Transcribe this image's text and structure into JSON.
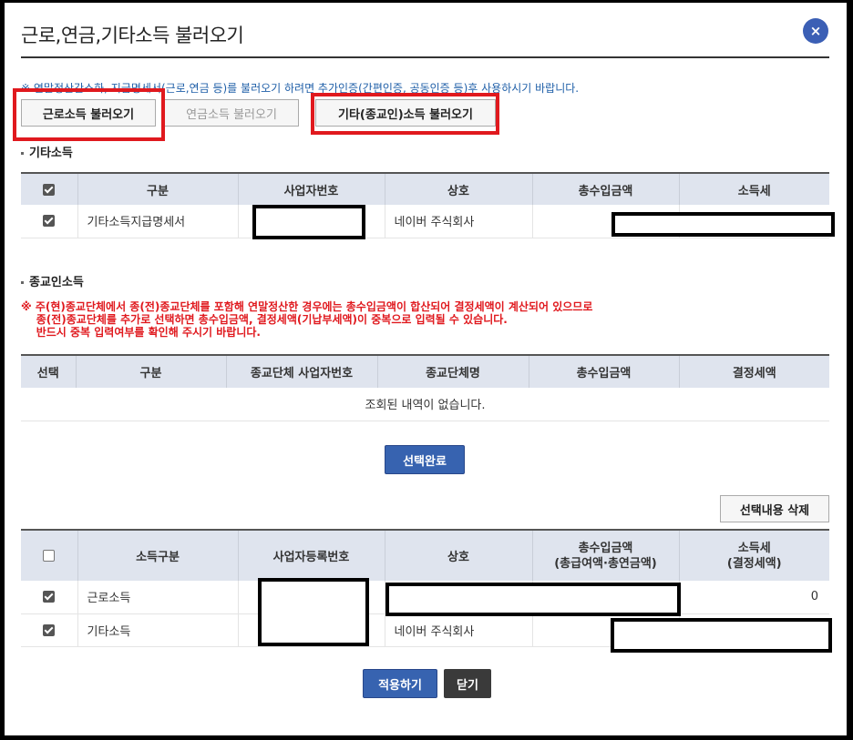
{
  "dialog": {
    "title": "근로,연금,기타소득 불러오기",
    "close_label": "×",
    "notice": "※ 연말정산간소화, 지급명세서(근로,연금 등)를 불러오기 하려면 추가인증(간편인증, 공동인증 등)후 사용하시기 바랍니다."
  },
  "buttons": {
    "labor_load": "근로소득 불러오기",
    "pension_load": "연금소득 불러오기",
    "other_load": "기타(종교인)소득 불러오기",
    "select_done": "선택완료",
    "delete_selected": "선택내용 삭제",
    "apply": "적용하기",
    "close": "닫기"
  },
  "other_income": {
    "section_title": "기타소득",
    "headers": [
      "",
      "구분",
      "사업자번호",
      "상호",
      "총수입금액",
      "소득세"
    ],
    "rows": [
      {
        "checked": true,
        "type": "기타소득지급명세서",
        "biz_no": "",
        "company": "네이버 주식회사",
        "total": "",
        "tax": ""
      }
    ]
  },
  "religious_income": {
    "section_title": "종교인소득",
    "warning": "※ 주(현)종교단체에서 종(전)종교단체를 포함해 연말정산한 경우에는 총수입금액이 합산되어 결정세액이 계산되어 있으므로\n    종(전)종교단체를 추가로 선택하면 총수입금액, 결정세액(기납부세액)이 중복으로 입력될 수 있습니다.\n    반드시 중복 입력여부를 확인해 주시기 바랍니다.",
    "headers": [
      "선택",
      "구분",
      "종교단체 사업자번호",
      "종교단체명",
      "총수입금액",
      "결정세액"
    ],
    "empty_message": "조회된 내역이 없습니다."
  },
  "summary": {
    "headers": [
      "",
      "소득구분",
      "사업자등록번호",
      "상호",
      "총수입금액\n(총급여액·총연금액)",
      "소득세\n(결정세액)"
    ],
    "rows": [
      {
        "checked": true,
        "type": "근로소득",
        "biz_no": "",
        "company": "",
        "total": "",
        "tax": "0"
      },
      {
        "checked": true,
        "type": "기타소득",
        "biz_no": "",
        "company": "네이버 주식회사",
        "total": "",
        "tax": ""
      }
    ]
  },
  "colors": {
    "accent_blue": "#3763b0",
    "warning_red": "#e0191e",
    "header_bg": "#dfe4ee"
  }
}
